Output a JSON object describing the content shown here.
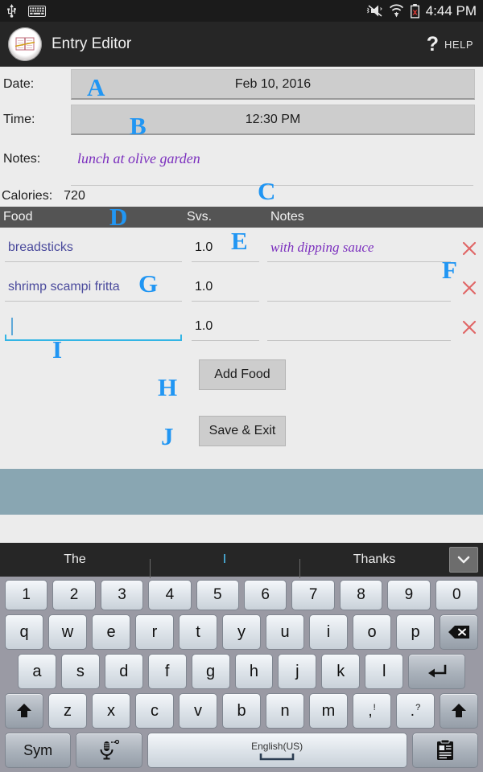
{
  "status_bar": {
    "icons_left": [
      "usb-icon",
      "keyboard-icon"
    ],
    "icons_right": [
      "volume-mute-icon",
      "wifi-icon",
      "battery-error-icon"
    ],
    "time": "4:44 PM"
  },
  "action_bar": {
    "logo": "plate-journal-icon",
    "title": "Entry Editor",
    "help_symbol": "?",
    "help_label": "HELP"
  },
  "form": {
    "date_label": "Date:",
    "date_value": "Feb 10, 2016",
    "time_label": "Time:",
    "time_value": "12:30 PM",
    "notes_label": "Notes:",
    "notes_value": "lunch at olive garden",
    "calories_label": "Calories:",
    "calories_value": "720"
  },
  "food_table": {
    "headers": {
      "food": "Food",
      "svs": "Svs.",
      "notes": "Notes"
    },
    "rows": [
      {
        "food": "breadsticks",
        "svs": "1.0",
        "notes": "with dipping sauce",
        "delete": "×",
        "focused": false
      },
      {
        "food": "shrimp scampi fritta",
        "svs": "1.0",
        "notes": "",
        "delete": "×",
        "focused": false
      },
      {
        "food": "",
        "svs": "1.0",
        "notes": "",
        "delete": "×",
        "focused": true
      }
    ]
  },
  "buttons": {
    "add_food": "Add Food",
    "save_exit": "Save & Exit"
  },
  "keyboard": {
    "suggestions": [
      {
        "text": "The",
        "active": false
      },
      {
        "text": "I",
        "active": true
      },
      {
        "text": "Thanks",
        "active": false
      }
    ],
    "expand_icon": "chevron-down-icon",
    "row_numbers": [
      "1",
      "2",
      "3",
      "4",
      "5",
      "6",
      "7",
      "8",
      "9",
      "0"
    ],
    "row_top": [
      "q",
      "w",
      "e",
      "r",
      "t",
      "y",
      "u",
      "i",
      "o",
      "p"
    ],
    "backspace_icon": "backspace-icon",
    "row_home": [
      "a",
      "s",
      "d",
      "f",
      "g",
      "h",
      "j",
      "k",
      "l"
    ],
    "enter_icon": "enter-icon",
    "row_bottom": [
      "z",
      "x",
      "c",
      "v",
      "b",
      "n",
      "m"
    ],
    "shift_icon": "shift-up-icon",
    "punct_comma": {
      "top": "!",
      "main": ","
    },
    "punct_period": {
      "top": "?",
      "main": "."
    },
    "sym_label": "Sym",
    "mic_icon": "microphone-icon",
    "space_label": "English(US)",
    "clipboard_icon": "clipboard-icon"
  },
  "markers": {
    "a": "A",
    "b": "B",
    "c": "C",
    "d": "D",
    "e": "E",
    "f": "F",
    "g": "G",
    "h": "H",
    "i": "I",
    "j": "J"
  },
  "colors": {
    "accent_blue": "#2196f3",
    "focus_underline": "#33b5e5",
    "notes_purple": "#7b2fbe",
    "food_text": "#4a4a9c",
    "delete_red": "#e06666",
    "teal_filler": "#89a6b2",
    "header_bar": "#545454"
  }
}
